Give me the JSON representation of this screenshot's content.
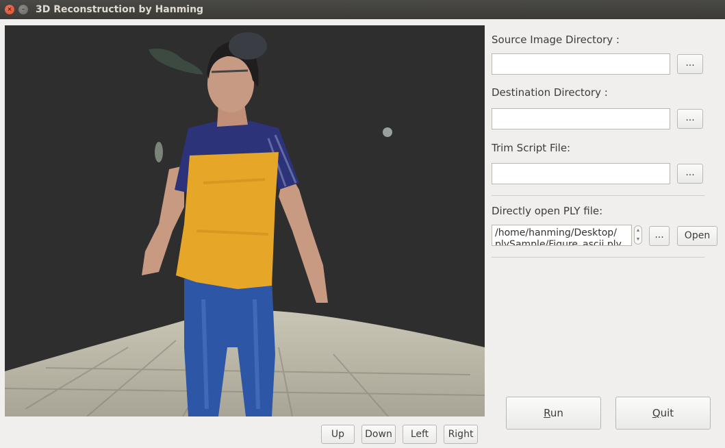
{
  "window": {
    "title": "3D Reconstruction by Hanming",
    "close_glyph": "×",
    "minimize_glyph": "–"
  },
  "controls": {
    "source_label": "Source Image Directory :",
    "dest_label": "Destination Directory :",
    "trim_label": "Trim Script File:",
    "ply_label": "Directly open PLY file:",
    "browse_label": "...",
    "open_label": "Open",
    "ply_path": "/home/hanming/Desktop/\nplySample/Figure_ascii.ply",
    "source_value": "",
    "dest_value": "",
    "trim_value": ""
  },
  "actions": {
    "run_mnemonic": "R",
    "run_rest": "un",
    "quit_mnemonic": "Q",
    "quit_rest": "uit"
  },
  "view_nav": {
    "up": "Up",
    "down": "Down",
    "left": "Left",
    "right": "Right"
  },
  "colors": {
    "viewport_bg": "#2e2e2e",
    "floor": "#c4c0b0",
    "shirt_yellow": "#e8a92a",
    "shirt_navy": "#2c3378",
    "jeans": "#2e5aa8",
    "skin": "#c89a82"
  }
}
